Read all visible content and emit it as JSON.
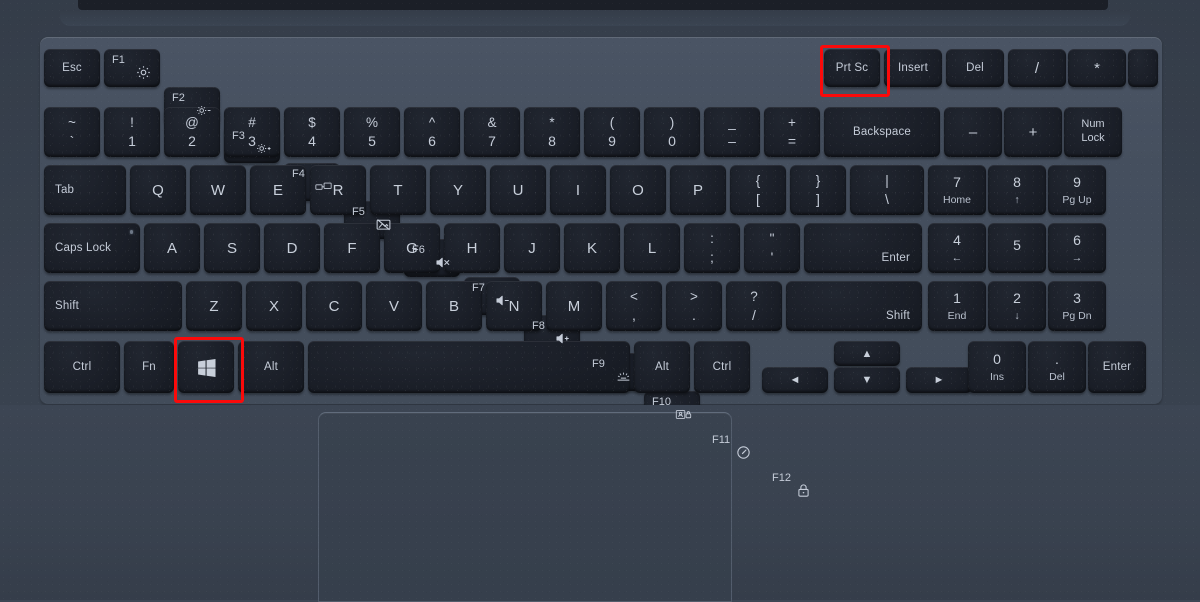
{
  "device": {
    "name": "laptop-keyboard",
    "chassis_color": "#3c4654",
    "key_color": "#1a1e27",
    "key_text_color": "#c5ccd8",
    "highlight_color": "#fb0a0a"
  },
  "highlights": [
    {
      "key": "Prt Sc",
      "label": "print-screen-key-highlight"
    },
    {
      "key": "Windows",
      "label": "windows-key-highlight"
    }
  ],
  "rows": [
    {
      "name": "function-row",
      "keys": [
        {
          "id": "esc",
          "label": "Esc",
          "type": "word"
        },
        {
          "id": "f1",
          "label": "F1",
          "type": "fn",
          "icon": "settings-icon"
        },
        {
          "id": "f2",
          "label": "F2",
          "type": "fn",
          "icon": "brightness-down-icon"
        },
        {
          "id": "f3",
          "label": "F3",
          "type": "fn",
          "icon": "brightness-up-icon"
        },
        {
          "id": "f4",
          "label": "F4",
          "type": "fn",
          "icon": "display-switch-icon"
        },
        {
          "id": "f5",
          "label": "F5",
          "type": "fn",
          "icon": "screen-off-icon"
        },
        {
          "id": "f6",
          "label": "F6",
          "type": "fn",
          "icon": "volume-mute-icon"
        },
        {
          "id": "f7",
          "label": "F7",
          "type": "fn",
          "icon": "volume-down-icon"
        },
        {
          "id": "f8",
          "label": "F8",
          "type": "fn",
          "icon": "volume-up-icon"
        },
        {
          "id": "f9",
          "label": "F9",
          "type": "fn",
          "icon": "keyboard-backlight-icon"
        },
        {
          "id": "f10",
          "label": "F10",
          "type": "fn",
          "icon": "privacy-screen-icon"
        },
        {
          "id": "f11",
          "label": "F11",
          "type": "fn",
          "icon": "performance-gauge-icon"
        },
        {
          "id": "f12",
          "label": "F12",
          "type": "fn",
          "icon": "lock-icon"
        },
        {
          "id": "prtsc",
          "label": "Prt Sc",
          "type": "word",
          "highlight": true
        },
        {
          "id": "insert",
          "label": "Insert",
          "type": "word"
        },
        {
          "id": "del",
          "label": "Del",
          "type": "word"
        },
        {
          "id": "npdiv",
          "label": "/",
          "type": "alpha"
        },
        {
          "id": "npmul",
          "label": "*",
          "type": "alpha"
        },
        {
          "id": "blank",
          "label": "",
          "type": "blank"
        }
      ]
    },
    {
      "name": "number-row",
      "keys": [
        {
          "id": "tilde",
          "top": "~",
          "bottom": "`",
          "type": "stack"
        },
        {
          "id": "1",
          "top": "!",
          "bottom": "1",
          "type": "stack"
        },
        {
          "id": "2",
          "top": "@",
          "bottom": "2",
          "type": "stack"
        },
        {
          "id": "3",
          "top": "#",
          "bottom": "3",
          "type": "stack"
        },
        {
          "id": "4",
          "top": "$",
          "bottom": "4",
          "type": "stack"
        },
        {
          "id": "5",
          "top": "%",
          "bottom": "5",
          "type": "stack"
        },
        {
          "id": "6",
          "top": "^",
          "bottom": "6",
          "type": "stack"
        },
        {
          "id": "7",
          "top": "&",
          "bottom": "7",
          "type": "stack"
        },
        {
          "id": "8",
          "top": "*",
          "bottom": "8",
          "type": "stack"
        },
        {
          "id": "9",
          "top": "(",
          "bottom": "9",
          "type": "stack"
        },
        {
          "id": "0",
          "top": ")",
          "bottom": "0",
          "type": "stack"
        },
        {
          "id": "minus",
          "top": "_",
          "bottom": "–",
          "type": "stack"
        },
        {
          "id": "equal",
          "top": "+",
          "bottom": "=",
          "type": "stack"
        },
        {
          "id": "backspace",
          "label": "Backspace",
          "type": "word"
        },
        {
          "id": "npminus",
          "label": "–",
          "type": "alpha"
        },
        {
          "id": "npplus",
          "label": "+",
          "type": "alpha"
        },
        {
          "id": "numlock",
          "line1": "Num",
          "line2": "Lock",
          "type": "twoline"
        }
      ]
    },
    {
      "name": "qwerty-row",
      "keys": [
        {
          "id": "tab",
          "label": "Tab",
          "type": "word-left"
        },
        {
          "id": "q",
          "label": "Q",
          "type": "alpha"
        },
        {
          "id": "w",
          "label": "W",
          "type": "alpha"
        },
        {
          "id": "e",
          "label": "E",
          "type": "alpha"
        },
        {
          "id": "r",
          "label": "R",
          "type": "alpha"
        },
        {
          "id": "t",
          "label": "T",
          "type": "alpha"
        },
        {
          "id": "y",
          "label": "Y",
          "type": "alpha"
        },
        {
          "id": "u",
          "label": "U",
          "type": "alpha"
        },
        {
          "id": "i",
          "label": "I",
          "type": "alpha"
        },
        {
          "id": "o",
          "label": "O",
          "type": "alpha"
        },
        {
          "id": "p",
          "label": "P",
          "type": "alpha"
        },
        {
          "id": "lbracket",
          "top": "{",
          "bottom": "[",
          "type": "stack"
        },
        {
          "id": "rbracket",
          "top": "}",
          "bottom": "]",
          "type": "stack"
        },
        {
          "id": "backslash",
          "top": "|",
          "bottom": "\\",
          "type": "stack"
        },
        {
          "id": "np7",
          "top": "7",
          "bottom": "Home",
          "type": "numpad"
        },
        {
          "id": "np8",
          "top": "8",
          "bottom": "↑",
          "type": "numpad"
        },
        {
          "id": "np9",
          "top": "9",
          "bottom": "Pg Up",
          "type": "numpad"
        }
      ]
    },
    {
      "name": "home-row",
      "keys": [
        {
          "id": "capslock",
          "label": "Caps Lock",
          "type": "word-left",
          "led": true
        },
        {
          "id": "a",
          "label": "A",
          "type": "alpha"
        },
        {
          "id": "s",
          "label": "S",
          "type": "alpha"
        },
        {
          "id": "d",
          "label": "D",
          "type": "alpha"
        },
        {
          "id": "f",
          "label": "F",
          "type": "alpha"
        },
        {
          "id": "g",
          "label": "G",
          "type": "alpha"
        },
        {
          "id": "h",
          "label": "H",
          "type": "alpha"
        },
        {
          "id": "j",
          "label": "J",
          "type": "alpha"
        },
        {
          "id": "k",
          "label": "K",
          "type": "alpha"
        },
        {
          "id": "l",
          "label": "L",
          "type": "alpha"
        },
        {
          "id": "semicolon",
          "top": ":",
          "bottom": ";",
          "type": "stack"
        },
        {
          "id": "quote",
          "top": "\"",
          "bottom": "'",
          "type": "stack"
        },
        {
          "id": "enter",
          "label": "Enter",
          "type": "word-br"
        },
        {
          "id": "np4",
          "top": "4",
          "bottom": "←",
          "type": "numpad"
        },
        {
          "id": "np5",
          "top": "5",
          "bottom": "",
          "type": "numpad"
        },
        {
          "id": "np6",
          "top": "6",
          "bottom": "→",
          "type": "numpad"
        }
      ]
    },
    {
      "name": "shift-row",
      "keys": [
        {
          "id": "lshift",
          "label": "Shift",
          "type": "word-left"
        },
        {
          "id": "z",
          "label": "Z",
          "type": "alpha"
        },
        {
          "id": "x",
          "label": "X",
          "type": "alpha"
        },
        {
          "id": "c",
          "label": "C",
          "type": "alpha"
        },
        {
          "id": "v",
          "label": "V",
          "type": "alpha"
        },
        {
          "id": "b",
          "label": "B",
          "type": "alpha"
        },
        {
          "id": "n",
          "label": "N",
          "type": "alpha"
        },
        {
          "id": "m",
          "label": "M",
          "type": "alpha"
        },
        {
          "id": "comma",
          "top": "<",
          "bottom": ",",
          "type": "stack"
        },
        {
          "id": "period",
          "top": ">",
          "bottom": ".",
          "type": "stack"
        },
        {
          "id": "slash",
          "top": "?",
          "bottom": "/",
          "type": "stack"
        },
        {
          "id": "rshift",
          "label": "Shift",
          "type": "word-br"
        },
        {
          "id": "np1",
          "top": "1",
          "bottom": "End",
          "type": "numpad"
        },
        {
          "id": "np2",
          "top": "2",
          "bottom": "↓",
          "type": "numpad"
        },
        {
          "id": "np3",
          "top": "3",
          "bottom": "Pg Dn",
          "type": "numpad"
        }
      ]
    },
    {
      "name": "bottom-row",
      "keys": [
        {
          "id": "lctrl",
          "label": "Ctrl",
          "type": "word"
        },
        {
          "id": "fn",
          "label": "Fn",
          "type": "word"
        },
        {
          "id": "win",
          "label": "",
          "type": "windows",
          "icon": "windows-logo-icon",
          "highlight": true
        },
        {
          "id": "lalt",
          "label": "Alt",
          "type": "word"
        },
        {
          "id": "space",
          "label": "",
          "type": "blank"
        },
        {
          "id": "ralt",
          "label": "Alt",
          "type": "word"
        },
        {
          "id": "rctrl",
          "label": "Ctrl",
          "type": "word"
        },
        {
          "id": "left",
          "label": "◄",
          "type": "arrow"
        },
        {
          "id": "up",
          "label": "▲",
          "type": "arrow"
        },
        {
          "id": "down",
          "label": "▼",
          "type": "arrow"
        },
        {
          "id": "right",
          "label": "►",
          "type": "arrow"
        },
        {
          "id": "np0",
          "top": "0",
          "bottom": "Ins",
          "type": "numpad"
        },
        {
          "id": "npdot",
          "top": ".",
          "bottom": "Del",
          "type": "numpad"
        },
        {
          "id": "npenter",
          "label": "Enter",
          "type": "word"
        }
      ]
    }
  ],
  "trackpad": {
    "name": "trackpad"
  }
}
